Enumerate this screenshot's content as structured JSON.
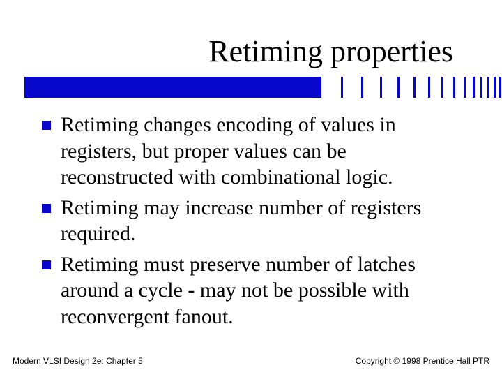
{
  "title": "Retiming properties",
  "bullets": [
    "Retiming changes encoding of values in registers, but proper values can be reconstructed with combinational logic.",
    "Retiming may increase number of registers required.",
    "Retiming must preserve number of latches around a cycle - may not be possible with reconvergent fanout."
  ],
  "footer": {
    "left": "Modern VLSI Design 2e: Chapter 5",
    "right": "Copyright © 1998 Prentice Hall PTR"
  },
  "divider": {
    "color": "#0808ca",
    "tick_gaps": [
      28,
      26,
      24,
      22,
      20,
      18,
      16,
      14,
      12,
      10,
      8,
      7,
      6,
      5,
      4,
      3,
      3
    ]
  }
}
